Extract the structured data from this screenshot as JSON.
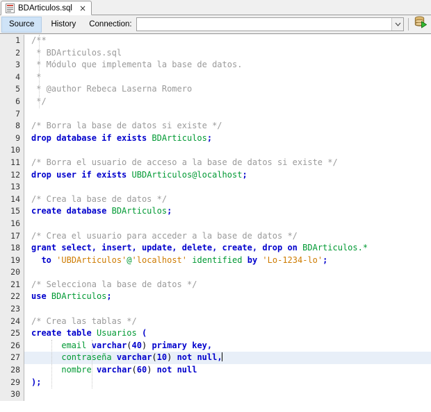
{
  "window": {
    "title": "BDArticulos.sql"
  },
  "tab": {
    "label": "BDArticulos.sql",
    "close_label": "×",
    "icon": "sql-file-icon"
  },
  "toolbar": {
    "source_label": "Source",
    "history_label": "History",
    "connection_label": "Connection:",
    "connection_value": "",
    "connection_placeholder": "",
    "dropdown_icon": "chevron-down-icon",
    "run_icon": "run-sql-database-icon"
  },
  "colors": {
    "keyword": "#0000cc",
    "identifier": "#009933",
    "comment": "#9a9a9a",
    "string": "#ce7b00",
    "current_line": "#e8eff8",
    "gutter_bg": "#ececec",
    "active_toggle": "#cfe3f7"
  },
  "editor": {
    "current_line": 27,
    "total_lines": 30,
    "lines": [
      {
        "n": 1,
        "tokens": [
          {
            "t": "com",
            "s": "/**"
          }
        ]
      },
      {
        "n": 2,
        "tokens": [
          {
            "t": "com",
            "s": " * BDArticulos.sql"
          }
        ]
      },
      {
        "n": 3,
        "tokens": [
          {
            "t": "com",
            "s": " * Módulo que implementa la base de datos."
          }
        ]
      },
      {
        "n": 4,
        "tokens": [
          {
            "t": "com",
            "s": " *"
          }
        ]
      },
      {
        "n": 5,
        "tokens": [
          {
            "t": "com",
            "s": " * @author Rebeca Laserna Romero"
          }
        ]
      },
      {
        "n": 6,
        "tokens": [
          {
            "t": "com",
            "s": " */"
          }
        ]
      },
      {
        "n": 7,
        "tokens": []
      },
      {
        "n": 8,
        "tokens": [
          {
            "t": "com",
            "s": "/* Borra la base de datos si existe */"
          }
        ]
      },
      {
        "n": 9,
        "tokens": [
          {
            "t": "kw",
            "s": "drop database if exists"
          },
          {
            "t": "pl",
            "s": " "
          },
          {
            "t": "id",
            "s": "BDArticulos"
          },
          {
            "t": "kw",
            "s": ";"
          }
        ]
      },
      {
        "n": 10,
        "tokens": []
      },
      {
        "n": 11,
        "tokens": [
          {
            "t": "com",
            "s": "/* Borra el usuario de acceso a la base de datos si existe */"
          }
        ]
      },
      {
        "n": 12,
        "tokens": [
          {
            "t": "kw",
            "s": "drop user if exists"
          },
          {
            "t": "pl",
            "s": " "
          },
          {
            "t": "id",
            "s": "UBDArticulos@localhost"
          },
          {
            "t": "kw",
            "s": ";"
          }
        ]
      },
      {
        "n": 13,
        "tokens": []
      },
      {
        "n": 14,
        "tokens": [
          {
            "t": "com",
            "s": "/* Crea la base de datos */"
          }
        ]
      },
      {
        "n": 15,
        "tokens": [
          {
            "t": "kw",
            "s": "create database"
          },
          {
            "t": "pl",
            "s": " "
          },
          {
            "t": "id",
            "s": "BDArticulos"
          },
          {
            "t": "kw",
            "s": ";"
          }
        ]
      },
      {
        "n": 16,
        "tokens": []
      },
      {
        "n": 17,
        "tokens": [
          {
            "t": "com",
            "s": "/* Crea el usuario para acceder a la base de datos */"
          }
        ]
      },
      {
        "n": 18,
        "tokens": [
          {
            "t": "kw",
            "s": "grant select, insert, update, delete, create, drop on"
          },
          {
            "t": "pl",
            "s": " "
          },
          {
            "t": "id",
            "s": "BDArticulos.*"
          }
        ]
      },
      {
        "n": 19,
        "tokens": [
          {
            "t": "pl",
            "s": "  "
          },
          {
            "t": "kw",
            "s": "to"
          },
          {
            "t": "pl",
            "s": " "
          },
          {
            "t": "str",
            "s": "'UBDArticulos'"
          },
          {
            "t": "id",
            "s": "@"
          },
          {
            "t": "str",
            "s": "'localhost'"
          },
          {
            "t": "pl",
            "s": " "
          },
          {
            "t": "id",
            "s": "identified"
          },
          {
            "t": "pl",
            "s": " "
          },
          {
            "t": "kw",
            "s": "by"
          },
          {
            "t": "pl",
            "s": " "
          },
          {
            "t": "str",
            "s": "'Lo-1234-lo'"
          },
          {
            "t": "kw",
            "s": ";"
          }
        ]
      },
      {
        "n": 20,
        "tokens": []
      },
      {
        "n": 21,
        "tokens": [
          {
            "t": "com",
            "s": "/* Selecciona la base de datos */"
          }
        ]
      },
      {
        "n": 22,
        "tokens": [
          {
            "t": "kw",
            "s": "use"
          },
          {
            "t": "pl",
            "s": " "
          },
          {
            "t": "id",
            "s": "BDArticulos"
          },
          {
            "t": "kw",
            "s": ";"
          }
        ]
      },
      {
        "n": 23,
        "tokens": []
      },
      {
        "n": 24,
        "tokens": [
          {
            "t": "com",
            "s": "/* Crea las tablas */"
          }
        ]
      },
      {
        "n": 25,
        "tokens": [
          {
            "t": "kw",
            "s": "create table"
          },
          {
            "t": "pl",
            "s": " "
          },
          {
            "t": "id",
            "s": "Usuarios"
          },
          {
            "t": "pl",
            "s": " "
          },
          {
            "t": "kw",
            "s": "("
          }
        ]
      },
      {
        "n": 26,
        "tokens": [
          {
            "t": "pl",
            "s": "      "
          },
          {
            "t": "id",
            "s": "email"
          },
          {
            "t": "pl",
            "s": " "
          },
          {
            "t": "kw",
            "s": "varchar"
          },
          {
            "t": "pl",
            "s": "("
          },
          {
            "t": "kw",
            "s": "40"
          },
          {
            "t": "pl",
            "s": ") "
          },
          {
            "t": "kw",
            "s": "primary key,"
          }
        ]
      },
      {
        "n": 27,
        "tokens": [
          {
            "t": "pl",
            "s": "      "
          },
          {
            "t": "id",
            "s": "contraseña"
          },
          {
            "t": "pl",
            "s": " "
          },
          {
            "t": "kw",
            "s": "varchar"
          },
          {
            "t": "pl",
            "s": "("
          },
          {
            "t": "kw",
            "s": "10"
          },
          {
            "t": "pl",
            "s": ") "
          },
          {
            "t": "kw",
            "s": "not null,"
          }
        ]
      },
      {
        "n": 28,
        "tokens": [
          {
            "t": "pl",
            "s": "      "
          },
          {
            "t": "id",
            "s": "nombre"
          },
          {
            "t": "pl",
            "s": " "
          },
          {
            "t": "kw",
            "s": "varchar"
          },
          {
            "t": "pl",
            "s": "("
          },
          {
            "t": "kw",
            "s": "60"
          },
          {
            "t": "pl",
            "s": ") "
          },
          {
            "t": "kw",
            "s": "not null"
          }
        ]
      },
      {
        "n": 29,
        "tokens": [
          {
            "t": "kw",
            "s": ");"
          }
        ]
      },
      {
        "n": 30,
        "tokens": []
      }
    ]
  }
}
